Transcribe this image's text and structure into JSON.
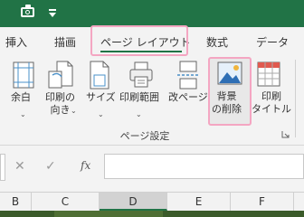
{
  "tabs": [
    "挿入",
    "描画",
    "ページ レイアウト",
    "数式",
    "データ"
  ],
  "ribbon": {
    "margins": [
      "余白"
    ],
    "orientation": [
      "印刷の",
      "向き"
    ],
    "size": [
      "サイズ"
    ],
    "print_area": [
      "印刷範囲"
    ],
    "breaks": [
      "改ページ"
    ],
    "background": [
      "背景",
      "の削除"
    ],
    "print_titles": [
      "印刷",
      "タイトル"
    ],
    "group_label": "ページ設定"
  },
  "formula_bar": {
    "fx_label": "fx",
    "cancel": "✕",
    "enter": "✓",
    "value": ""
  },
  "columns": [
    "B",
    "C",
    "D",
    "E",
    "F"
  ],
  "selected_column": "D",
  "colors": {
    "titlebar": "#217346",
    "highlight": "#f4a6c2",
    "accent": "#217346"
  }
}
